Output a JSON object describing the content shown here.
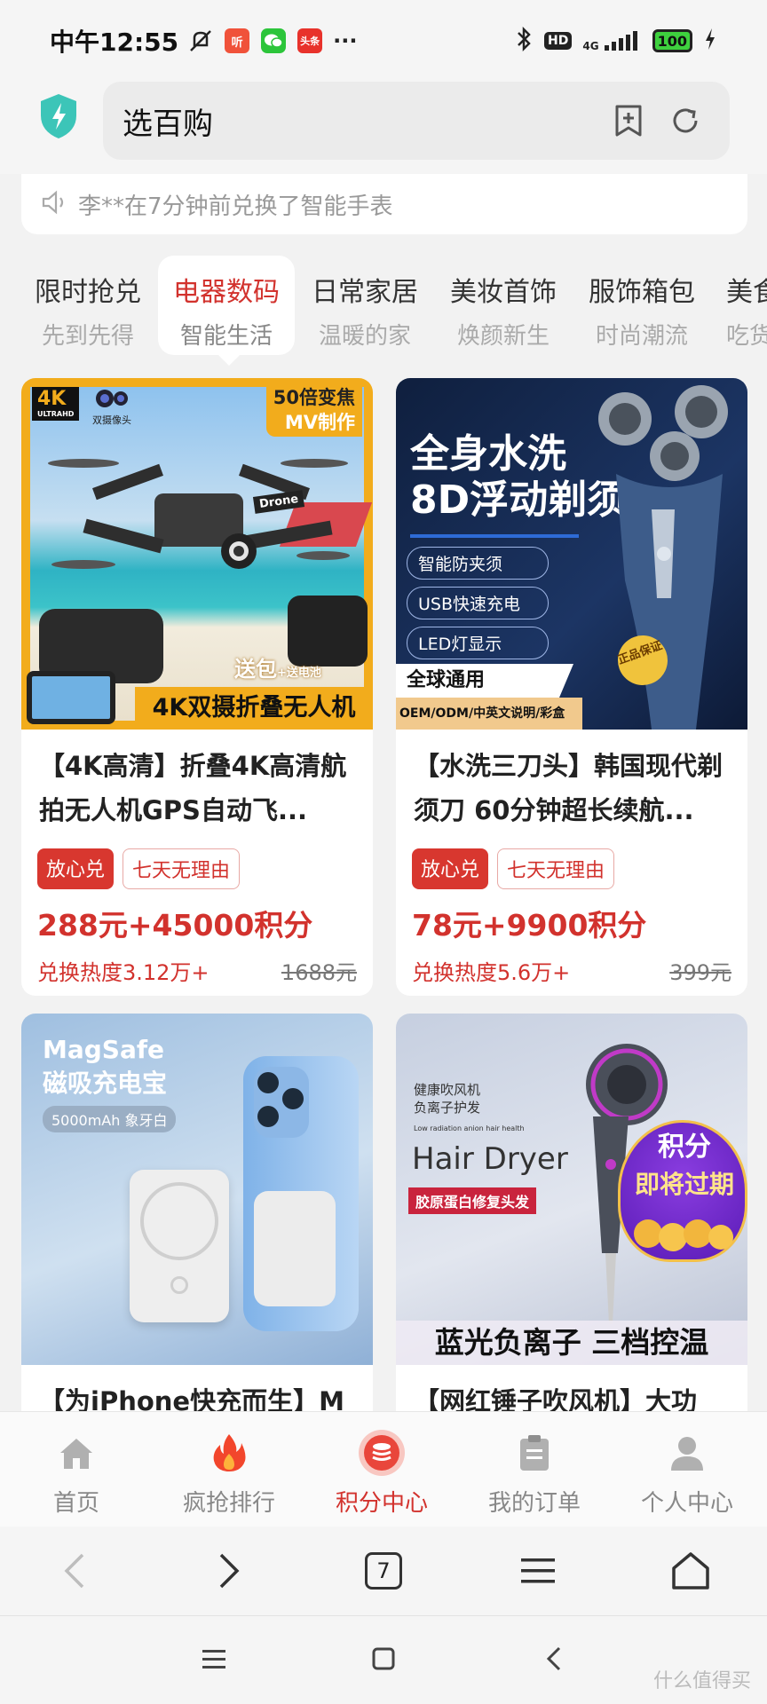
{
  "status": {
    "time": "中午12:55",
    "app_badges": [
      "听",
      "头条"
    ],
    "more": "···",
    "hd": "HD",
    "network": "4G",
    "battery": "100"
  },
  "header": {
    "title": "选百购"
  },
  "notice": {
    "text": "李**在7分钟前兑换了智能手表"
  },
  "categories": [
    {
      "title": "限时抢兑",
      "subtitle": "先到先得"
    },
    {
      "title": "电器数码",
      "subtitle": "智能生活"
    },
    {
      "title": "日常家居",
      "subtitle": "温暖的家"
    },
    {
      "title": "美妆首饰",
      "subtitle": "焕颜新生"
    },
    {
      "title": "服饰箱包",
      "subtitle": "时尚潮流"
    },
    {
      "title": "美食",
      "subtitle": "吃货"
    }
  ],
  "products": [
    {
      "title": "【4K高清】折叠4K高清航拍无人机GPS自动飞...",
      "tag1": "放心兑",
      "tag2": "七天无理由",
      "price": "288元+45000积分",
      "heat": "兑换热度3.12万+",
      "original": "1688元",
      "img": {
        "t1": "4K",
        "t2": "ULTRAHD",
        "t3": "双摄像头",
        "t4": "50倍变焦",
        "t5": "MV制作",
        "t6": "Drone",
        "t7": "送包",
        "t8": "+送电池",
        "t9": "4K双摄折叠无人机"
      }
    },
    {
      "title": "【水洗三刀头】韩国现代剃须刀 60分钟超长续航...",
      "tag1": "放心兑",
      "tag2": "七天无理由",
      "price": "78元+9900积分",
      "heat": "兑换热度5.6万+",
      "original": "399元",
      "img": {
        "t1": "全身水洗",
        "t2": "8D浮动剃须",
        "f1": "智能防夹须",
        "f2": "USB快速充电",
        "f3": "LED灯显示",
        "t3": "全球通用",
        "t4": "OEM/ODM/中英文说明/彩盒",
        "t5": "正品保证"
      }
    },
    {
      "title": "【为iPhone快充而生】M",
      "img": {
        "t1": "MagSafe",
        "t2": "磁吸充电宝",
        "t3": "5000mAh 象牙白"
      }
    },
    {
      "title": "【网红锤子吹风机】大功",
      "img": {
        "t1": "健康吹风机",
        "t2": "负离子护发",
        "t3": "Low radiation anion hair health",
        "t4": "Hair Dryer",
        "t5": "胶原蛋白修复头发",
        "t6": "蓝光负离子 三档控温",
        "b1": "积分",
        "b2": "即将过期"
      }
    }
  ],
  "bottom_nav": [
    {
      "label": "首页",
      "icon": "home-icon"
    },
    {
      "label": "疯抢排行",
      "icon": "fire-icon"
    },
    {
      "label": "积分中心",
      "icon": "coins-icon"
    },
    {
      "label": "我的订单",
      "icon": "clipboard-icon"
    },
    {
      "label": "个人中心",
      "icon": "user-icon"
    }
  ],
  "browser": {
    "tabs_count": "7"
  },
  "watermark": "什么值得买"
}
